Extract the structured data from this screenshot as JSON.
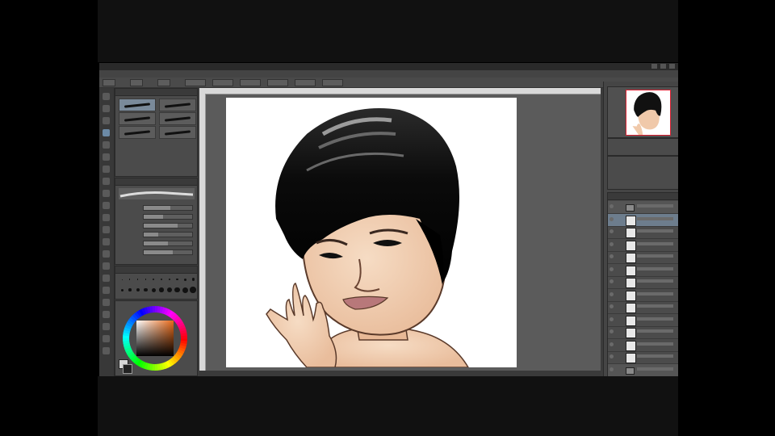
{
  "app": {
    "title_text": ""
  },
  "toolbar": {
    "button_count": 9
  },
  "menu": {
    "items": []
  },
  "tools": {
    "count": 22
  },
  "sub_tool": {
    "tiles": [
      {
        "selected": true
      },
      {
        "selected": false
      },
      {
        "selected": false
      },
      {
        "selected": false
      },
      {
        "selected": false
      },
      {
        "selected": false
      }
    ]
  },
  "tool_property": {
    "rows": [
      {
        "value": 0.55
      },
      {
        "value": 0.4
      },
      {
        "value": 0.7
      },
      {
        "value": 0.3
      },
      {
        "value": 0.5
      },
      {
        "value": 0.6
      }
    ]
  },
  "color": {
    "hue_selected": "#e86a1a",
    "main": "#d8d8d8",
    "sub": "#222222"
  },
  "layers": {
    "rows": [
      {
        "type": "folder",
        "selected": false
      },
      {
        "type": "layer",
        "selected": true
      },
      {
        "type": "layer",
        "selected": false
      },
      {
        "type": "layer",
        "selected": false
      },
      {
        "type": "layer",
        "selected": false
      },
      {
        "type": "layer",
        "selected": false
      },
      {
        "type": "layer",
        "selected": false
      },
      {
        "type": "layer",
        "selected": false
      },
      {
        "type": "layer",
        "selected": false
      },
      {
        "type": "layer",
        "selected": false
      },
      {
        "type": "layer",
        "selected": false
      },
      {
        "type": "layer",
        "selected": false
      },
      {
        "type": "layer",
        "selected": false
      },
      {
        "type": "folder",
        "selected": false
      }
    ]
  },
  "colors": {
    "ui_dark": "#3c3c3c",
    "panel": "#4b4b4b",
    "canvas_bg": "#5b5b5b",
    "hair": "#0d0d0d",
    "skin": "#f3d2b6",
    "lips": "#b8787a"
  }
}
